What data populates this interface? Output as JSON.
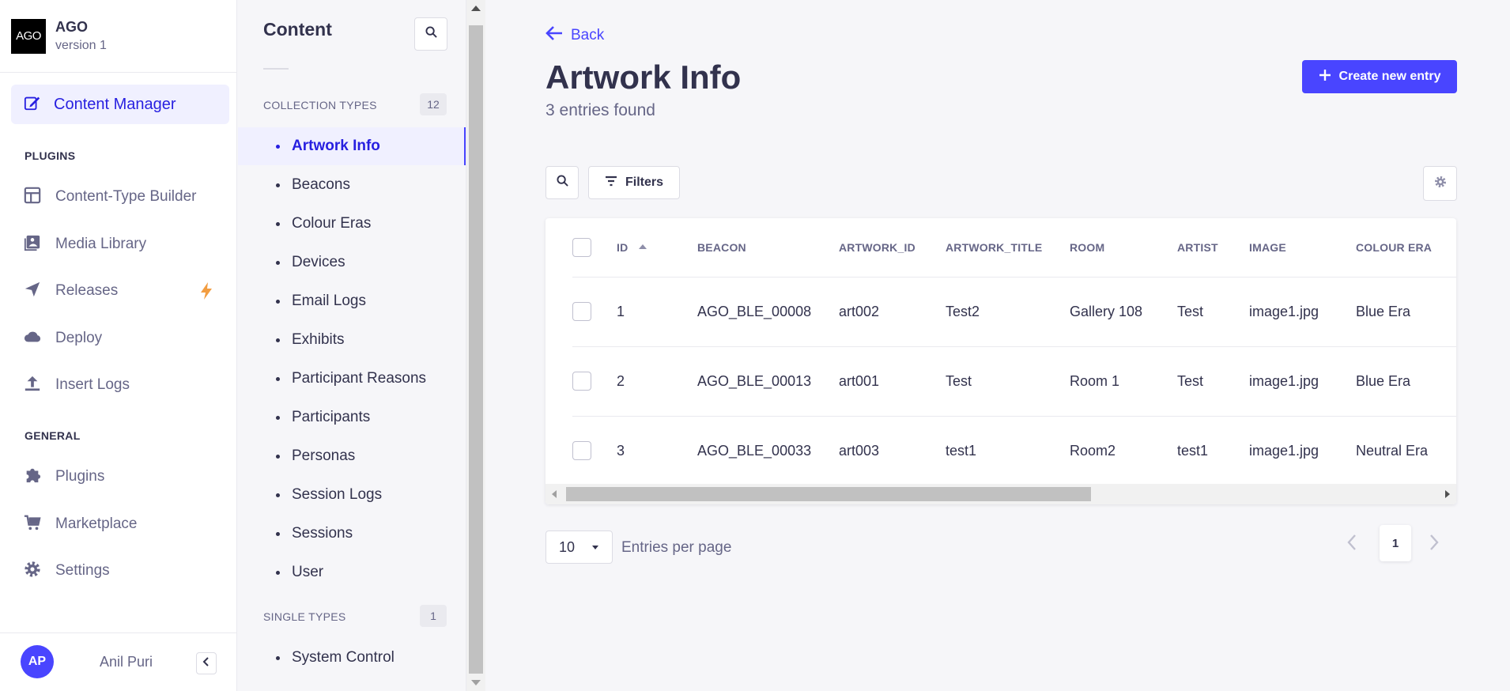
{
  "brand": {
    "logo_text": "AGO",
    "title": "AGO",
    "subtitle": "version 1"
  },
  "mainnav": {
    "active": {
      "label": "Content Manager",
      "icon": "feather-pencil-icon"
    },
    "plugins_heading": "PLUGINS",
    "plugins": [
      {
        "label": "Content-Type Builder",
        "icon": "layout-icon"
      },
      {
        "label": "Media Library",
        "icon": "image-icon"
      },
      {
        "label": "Releases",
        "icon": "paper-plane-icon",
        "badge_icon": "lightning-icon"
      },
      {
        "label": "Deploy",
        "icon": "cloud-icon"
      },
      {
        "label": "Insert Logs",
        "icon": "upload-icon"
      }
    ],
    "general_heading": "GENERAL",
    "general": [
      {
        "label": "Plugins",
        "icon": "puzzle-icon"
      },
      {
        "label": "Marketplace",
        "icon": "cart-icon"
      },
      {
        "label": "Settings",
        "icon": "gear-icon"
      }
    ]
  },
  "user": {
    "initials": "AP",
    "name": "Anil Puri"
  },
  "subnav": {
    "title": "Content",
    "collection_heading": "COLLECTION TYPES",
    "collection_count": "12",
    "collection_items": [
      "Artwork Info",
      "Beacons",
      "Colour Eras",
      "Devices",
      "Email Logs",
      "Exhibits",
      "Participant Reasons",
      "Participants",
      "Personas",
      "Session Logs",
      "Sessions",
      "User"
    ],
    "active_item": "Artwork Info",
    "single_heading": "SINGLE TYPES",
    "single_count": "1",
    "single_items": [
      "System Control"
    ]
  },
  "header": {
    "back_label": "Back",
    "title": "Artwork Info",
    "subtitle": "3 entries found",
    "create_label": "Create new entry"
  },
  "toolbar": {
    "filters_label": "Filters"
  },
  "table": {
    "columns": [
      "ID",
      "BEACON",
      "ARTWORK_ID",
      "ARTWORK_TITLE",
      "ROOM",
      "ARTIST",
      "IMAGE",
      "COLOUR ERA"
    ],
    "rows": [
      [
        "1",
        "AGO_BLE_00008",
        "art002",
        "Test2",
        "Gallery 108",
        "Test",
        "image1.jpg",
        "Blue Era"
      ],
      [
        "2",
        "AGO_BLE_00013",
        "art001",
        "Test",
        "Room 1",
        "Test",
        "image1.jpg",
        "Blue Era"
      ],
      [
        "3",
        "AGO_BLE_00033",
        "art003",
        "test1",
        "Room2",
        "test1",
        "image1.jpg",
        "Neutral Era"
      ]
    ]
  },
  "pagination": {
    "per_page_value": "10",
    "per_page_label": "Entries per page",
    "current_page": "1"
  },
  "colors": {
    "primary": "#4945ff",
    "active_bg": "#f0f0ff",
    "text": "#32324d",
    "muted": "#666687",
    "bolt": "#f29d41"
  }
}
